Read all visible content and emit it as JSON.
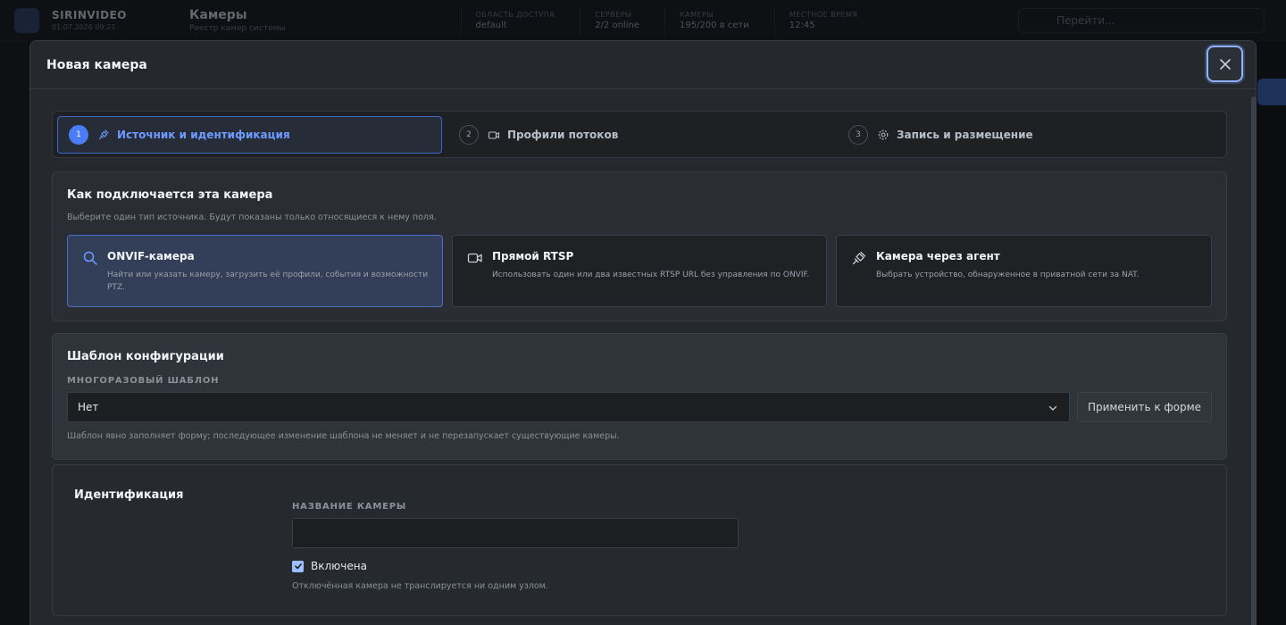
{
  "background": {
    "brand_title": "SIRINVIDEO",
    "brand_sub": "01.07.2026 09:21",
    "page_title": "Камеры",
    "page_sub": "Реестр камер системы",
    "stats": [
      {
        "label": "ОБЛАСТЬ ДОСТУПА",
        "value": "default"
      },
      {
        "label": "СЕРВЕРЫ",
        "value": "2/2 online"
      },
      {
        "label": "КАМЕРЫ",
        "value": "195/200 в сети"
      },
      {
        "label": "МЕСТНОЕ ВРЕМЯ",
        "value": "12:45"
      }
    ],
    "search_placeholder": "Перейти..."
  },
  "modal": {
    "title": "Новая камера",
    "steps": [
      {
        "num": "1",
        "label": "Источник и идентификация",
        "icon": "plug-icon"
      },
      {
        "num": "2",
        "label": "Профили потоков",
        "icon": "video-icon"
      },
      {
        "num": "3",
        "label": "Запись и размещение",
        "icon": "gear-icon"
      }
    ],
    "source": {
      "title": "Как подключается эта камера",
      "subtitle": "Выберите один тип источника. Будут показаны только относящиеся к нему поля.",
      "options": [
        {
          "title": "ONVIF-камера",
          "desc": "Найти или указать камеру, загрузить её профили, события и возможности PTZ.",
          "icon": "search-icon"
        },
        {
          "title": "Прямой RTSP",
          "desc": "Использовать один или два известных RTSP URL без управления по ONVIF.",
          "icon": "video-icon"
        },
        {
          "title": "Камера через агент",
          "desc": "Выбрать устройство, обнаруженное в приватной сети за NAT.",
          "icon": "plug-icon"
        }
      ]
    },
    "template": {
      "title": "Шаблон конфигурации",
      "field_label": "МНОГОРАЗОВЫЙ ШАБЛОН",
      "selected": "Нет",
      "apply_label": "Применить к форме",
      "hint": "Шаблон явно заполняет форму; последующее изменение шаблона не меняет и не перезапускает существующие камеры."
    },
    "identification": {
      "title": "Идентификация",
      "name_label": "НАЗВАНИЕ КАМЕРЫ",
      "name_value": "",
      "enabled_label": "Включена",
      "enabled": true,
      "hint": "Отключённая камера не транслируется ни одним узлом."
    }
  },
  "colors": {
    "accent": "#4a7cf5",
    "selected_bg": "#333e58"
  }
}
